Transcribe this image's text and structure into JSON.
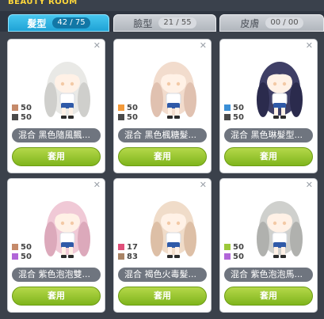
{
  "window": {
    "title": "BEAUTY ROOM"
  },
  "tabs": [
    {
      "label": "髮型",
      "count": "42 / 75",
      "active": true
    },
    {
      "label": "臉型",
      "count": "21 / 55",
      "active": false
    },
    {
      "label": "皮膚",
      "count": "00 / 00",
      "active": false
    }
  ],
  "cards": [
    {
      "name": "混合  黑色隨風飄...",
      "button": "套用",
      "hair": "#e9e9e6",
      "hairShade": "#cfcfcc",
      "colors": [
        {
          "hex": "#c58a6a",
          "value": "50"
        },
        {
          "hex": "#4a4a4a",
          "value": "50"
        }
      ]
    },
    {
      "name": "混合  黑色楓糖髮...",
      "button": "套用",
      "hair": "#f2dccd",
      "hairShade": "#e0c1b0",
      "colors": [
        {
          "hex": "#f39a3a",
          "value": "50"
        },
        {
          "hex": "#4a4a4a",
          "value": "50"
        }
      ]
    },
    {
      "name": "混合  黑色琳髮型...",
      "button": "套用",
      "hair": "#3f3f66",
      "hairShade": "#2b2b4d",
      "colors": [
        {
          "hex": "#3b8fd6",
          "value": "50"
        },
        {
          "hex": "#4a4a4a",
          "value": "50"
        }
      ]
    },
    {
      "name": "混合  紫色泡泡雙...",
      "button": "套用",
      "hair": "#f0c9d6",
      "hairShade": "#dca9bb",
      "colors": [
        {
          "hex": "#c58a6a",
          "value": "50"
        },
        {
          "hex": "#b166d8",
          "value": "50"
        }
      ]
    },
    {
      "name": "混合  褐色火毒髮...",
      "button": "套用",
      "hair": "#f0dcc9",
      "hairShade": "#ddbfa6",
      "colors": [
        {
          "hex": "#e0507a",
          "value": "17"
        },
        {
          "hex": "#a98466",
          "value": "83"
        }
      ]
    },
    {
      "name": "混合  紫色泡泡馬...",
      "button": "套用",
      "hair": "#cfd0cd",
      "hairShade": "#b0b1ae",
      "colors": [
        {
          "hex": "#9cc83a",
          "value": "50"
        },
        {
          "hex": "#b166d8",
          "value": "50"
        }
      ]
    }
  ]
}
